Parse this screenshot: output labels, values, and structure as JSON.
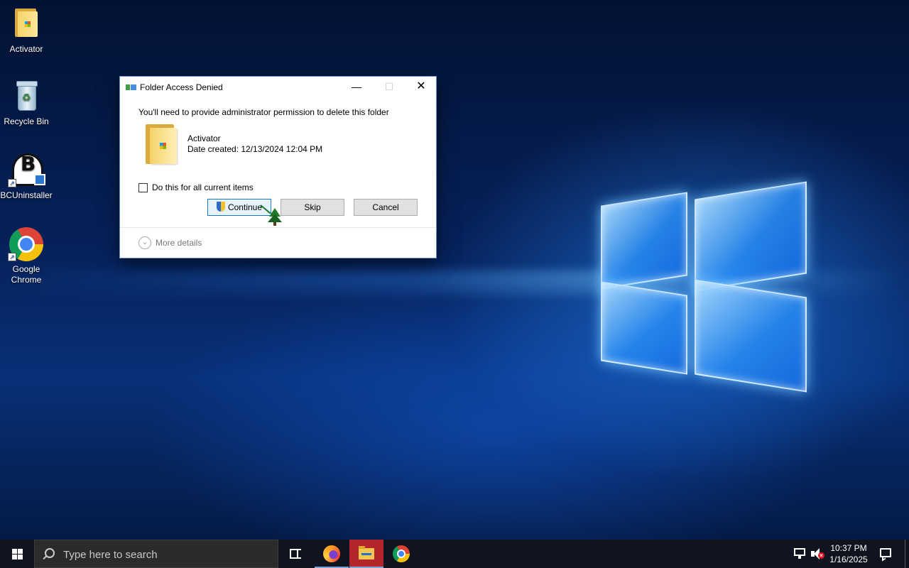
{
  "desktop": {
    "icons": [
      {
        "label": "Activator",
        "icon": "folder-icon"
      },
      {
        "label": "Recycle Bin",
        "icon": "recycle-bin-icon"
      },
      {
        "label": "BCUninstaller",
        "icon": "bcuninstaller-icon"
      },
      {
        "label": "Google Chrome",
        "icon": "chrome-icon"
      }
    ]
  },
  "dialog": {
    "title": "Folder Access Denied",
    "message": "You'll need to provide administrator permission to delete this folder",
    "item_name": "Activator",
    "item_date": "Date created: 12/13/2024 12:04 PM",
    "checkbox_label": "Do this for all current items",
    "checkbox_checked": false,
    "buttons": {
      "continue": "Continue",
      "skip": "Skip",
      "cancel": "Cancel"
    },
    "more_details": "More details",
    "window_controls": {
      "minimize": "—",
      "maximize": "☐",
      "close": "✕"
    }
  },
  "taskbar": {
    "search_placeholder": "Type here to search",
    "apps": [
      "task-view-icon",
      "firefox-icon",
      "file-explorer-icon",
      "chrome-icon"
    ],
    "clock_time": "10:37 PM",
    "clock_date": "1/16/2025"
  },
  "colors": {
    "dialog_focus_border": "#0078d7",
    "taskbar_bg": "#101420",
    "active_app_bg": "#b3242b"
  }
}
